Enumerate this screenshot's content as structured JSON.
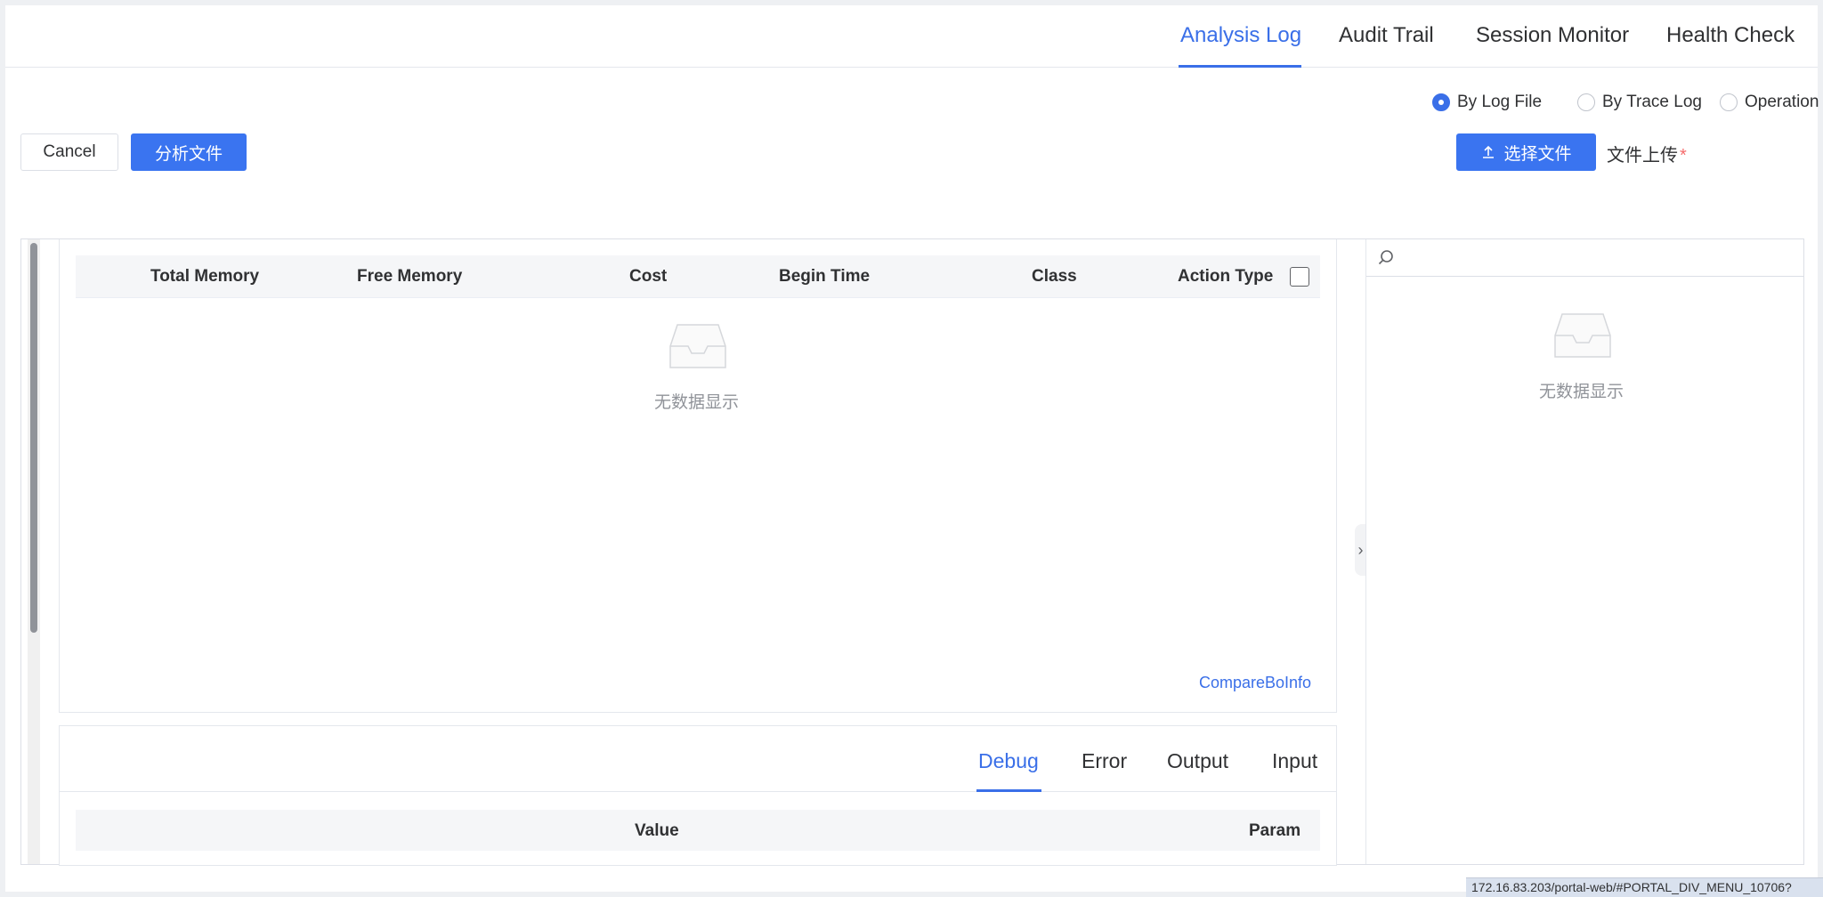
{
  "top_tabs": {
    "health_check": "Health Check",
    "session_monitor": "Session Monitor",
    "audit_trail": "Audit Trail",
    "analysis_log": "Analysis Log",
    "active": "Analysis Log"
  },
  "mode": {
    "options": [
      "Operation Type",
      "By Trace Log",
      "By Log File"
    ],
    "selected": "By Log File"
  },
  "upload": {
    "label": "文件上传",
    "required_mark": "*",
    "select_file_button": "选择文件"
  },
  "actions": {
    "analyze_button": "分析文件",
    "cancel_button": "Cancel"
  },
  "tree_panel": {
    "empty_text": "无数据显示"
  },
  "table": {
    "columns": [
      "Action Type",
      "Class",
      "Begin Time",
      "Cost",
      "Free Memory",
      "Total Memory"
    ],
    "empty_text": "无数据显示",
    "compare_link": "CompareBoInfo"
  },
  "detail_tabs": {
    "tabs": [
      "Input",
      "Output",
      "Error",
      "Debug"
    ],
    "active": "Debug",
    "columns": [
      "Param",
      "Value"
    ]
  },
  "status_url": "172.16.83.203/portal-web/#PORTAL_DIV_MENU_10706?",
  "colors": {
    "accent": "#3a6fe8",
    "primary_button": "#3a74f0",
    "required": "#f56c6c"
  }
}
